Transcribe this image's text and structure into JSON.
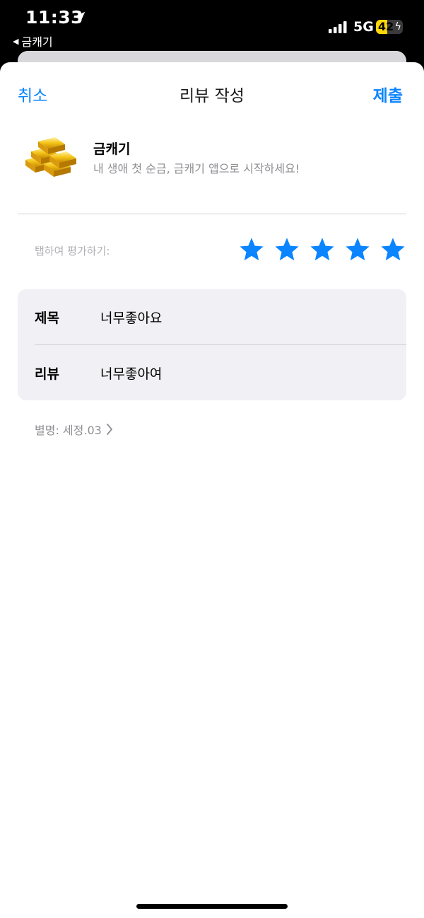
{
  "status_bar": {
    "time": "11:33",
    "back_app": "금캐기",
    "network": "5G",
    "battery_level": "42",
    "battery_percent": 42,
    "battery_color": "#ffd60a",
    "icons": [
      "location-arrow-icon",
      "back-triangle-icon",
      "signal-icon",
      "battery-icon",
      "charging-bolt-icon"
    ]
  },
  "nav": {
    "cancel": "취소",
    "title": "리뷰 작성",
    "submit": "제출"
  },
  "app": {
    "name": "금캐기",
    "subtitle": "내 생애 첫 순금, 금캐기 앱으로 시작하세요!",
    "icon": "gold-bars-icon"
  },
  "rating": {
    "label": "탭하여 평가하기:",
    "value": 5,
    "max": 5,
    "star_color": "#0a84ff"
  },
  "form": {
    "title_label": "제목",
    "title_value": "너무좋아요",
    "review_label": "리뷰",
    "review_value": "너무좋아여"
  },
  "nickname": {
    "text": "별명: 세정.03"
  },
  "colors": {
    "accent": "#0a84ff",
    "card_bg": "#f0f0f5"
  }
}
